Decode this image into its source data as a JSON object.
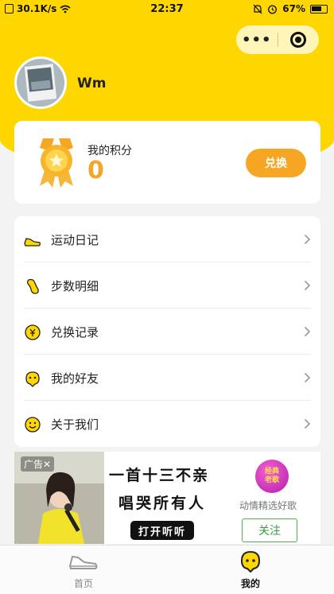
{
  "status_bar": {
    "network_speed": "30.1K/s",
    "time": "22:37",
    "battery": "67%"
  },
  "capsule": {
    "more": "•••"
  },
  "profile": {
    "username": "Wm"
  },
  "points_card": {
    "label": "我的积分",
    "value": "0",
    "exchange_label": "兑换"
  },
  "menu": {
    "items": [
      {
        "label": "运动日记",
        "icon": "shoe-icon"
      },
      {
        "label": "步数明细",
        "icon": "footprint-icon"
      },
      {
        "label": "兑换记录",
        "icon": "exchange-record-icon"
      },
      {
        "label": "我的好友",
        "icon": "friends-icon"
      },
      {
        "label": "关于我们",
        "icon": "smile-icon"
      }
    ]
  },
  "ad": {
    "tag": "广告✕",
    "headline_1": "一首十三不亲",
    "headline_2": "唱哭所有人",
    "cta": "打开听听",
    "logo_text_1": "经典",
    "logo_text_2": "老歌",
    "caption": "动情精选好歌",
    "follow": "关注"
  },
  "tabbar": {
    "tabs": [
      {
        "label": "首页",
        "icon": "sneaker-icon",
        "active": false
      },
      {
        "label": "我的",
        "icon": "profile-icon",
        "active": true
      }
    ]
  },
  "colors": {
    "brand_yellow": "#ffd700",
    "accent_orange": "#f6a623",
    "follow_green": "#4caf50"
  }
}
